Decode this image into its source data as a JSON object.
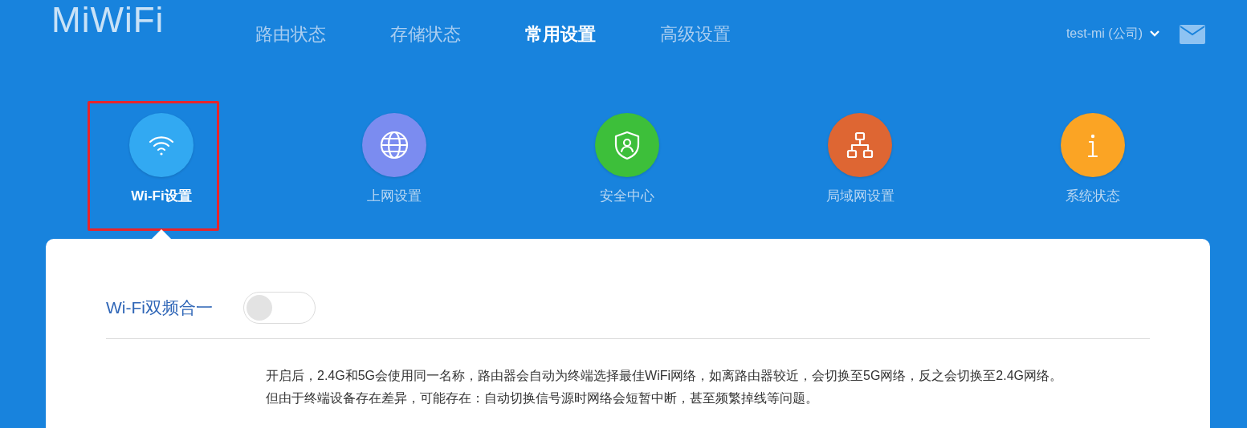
{
  "header": {
    "logo": "MiWiFi",
    "nav": [
      {
        "label": "路由状态",
        "selected": false
      },
      {
        "label": "存储状态",
        "selected": false
      },
      {
        "label": "常用设置",
        "selected": true
      },
      {
        "label": "高级设置",
        "selected": false
      }
    ],
    "user": "test-mi (公司)"
  },
  "categories": [
    {
      "kind": "wifi",
      "label": "Wi-Fi设置",
      "color": "#32a9f2",
      "selected": true,
      "highlighted": true
    },
    {
      "kind": "globe",
      "label": "上网设置",
      "color": "#7b8cf0",
      "selected": false,
      "highlighted": false
    },
    {
      "kind": "shield",
      "label": "安全中心",
      "color": "#3dbf3a",
      "selected": false,
      "highlighted": false
    },
    {
      "kind": "network",
      "label": "局域网设置",
      "color": "#de6633",
      "selected": false,
      "highlighted": false
    },
    {
      "kind": "info",
      "label": "系统状态",
      "color": "#fba424",
      "selected": false,
      "highlighted": false
    }
  ],
  "setting": {
    "label": "Wi-Fi双频合一",
    "on": false,
    "description": [
      "开启后，2.4G和5G会使用同一名称，路由器会自动为终端选择最佳WiFi网络，如离路由器较近，会切换至5G网络，反之会切换至2.4G网络。",
      "但由于终端设备存在差异，可能存在：自动切换信号源时网络会短暂中断，甚至频繁掉线等问题。"
    ]
  }
}
